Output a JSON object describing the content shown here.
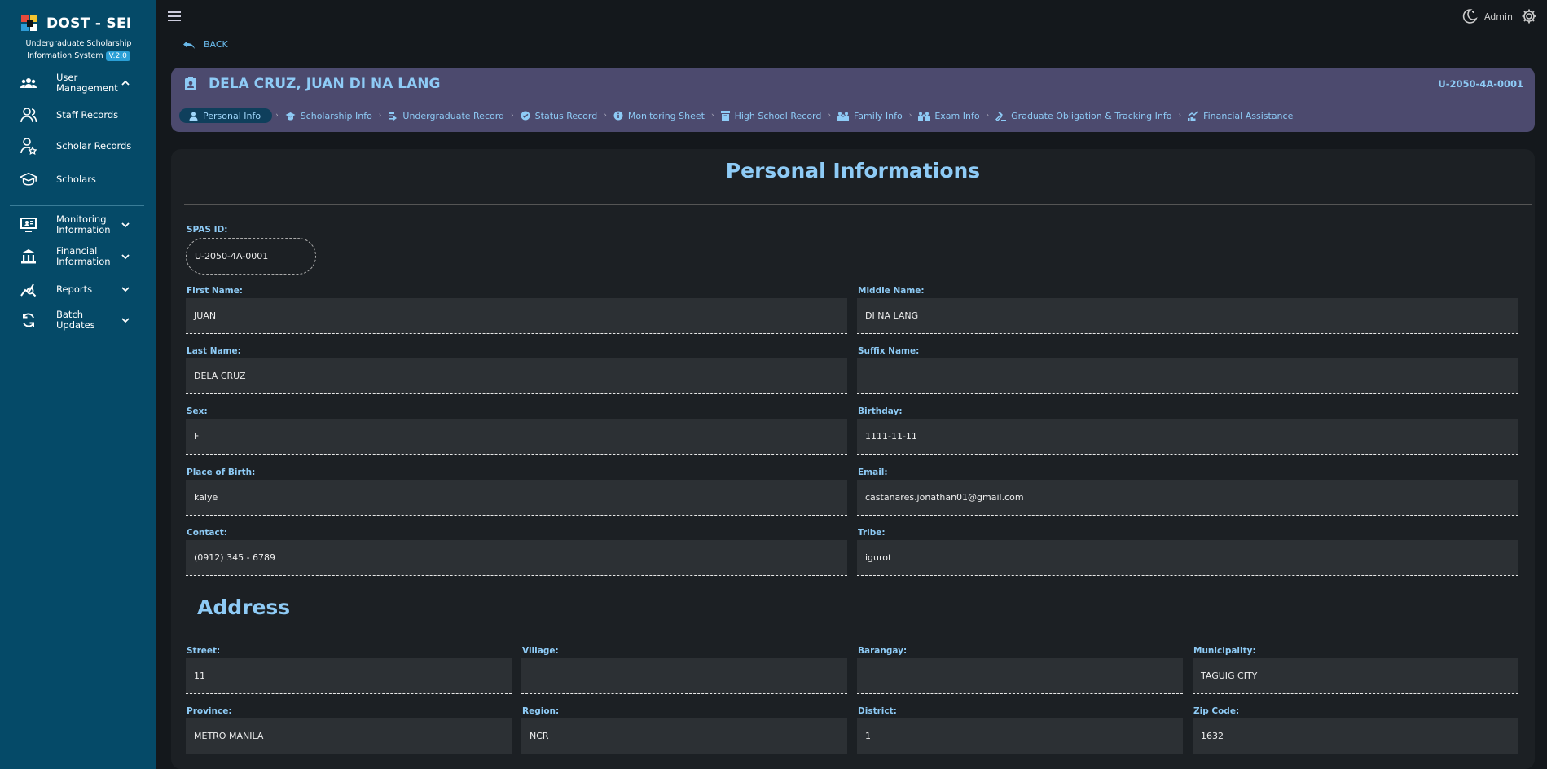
{
  "brand": {
    "title": "DOST - SEI",
    "subtitle_line1": "Undergraduate Scholarship",
    "subtitle_line2": "Information System",
    "version": "V.2.0"
  },
  "sidebar": {
    "items": [
      {
        "label1": "User",
        "label2": "Management",
        "icon": "users-icon"
      },
      {
        "label1": "Staff Records",
        "icon": "staff-icon"
      },
      {
        "label1": "Scholar Records",
        "icon": "scholar-records-icon"
      },
      {
        "label1": "Scholars",
        "icon": "graduation-cap-icon"
      },
      {
        "label1": "Monitoring",
        "label2": "Information",
        "icon": "monitor-icon"
      },
      {
        "label1": "Financial",
        "label2": "Information",
        "icon": "bank-icon"
      },
      {
        "label1": "Reports",
        "icon": "reports-icon"
      },
      {
        "label1": "Batch",
        "label2": "Updates",
        "icon": "sync-icon"
      }
    ]
  },
  "topbar": {
    "user": "Admin"
  },
  "back_label": "BACK",
  "header": {
    "name": "DELA CRUZ, JUAN DI NA LANG",
    "id": "U-2050-4A-0001",
    "tabs": [
      "Personal Info",
      "Scholarship Info",
      "Undergraduate Record",
      "Status Record",
      "Monitoring Sheet",
      "High School Record",
      "Family Info",
      "Exam Info",
      "Graduate Obligation & Tracking Info",
      "Financial Assistance"
    ]
  },
  "personal": {
    "title": "Personal Informations",
    "spas_label": "SPAS ID:",
    "spas_value": "U-2050-4A-0001",
    "first_label": "First Name:",
    "first_value": "JUAN",
    "middle_label": "Middle Name:",
    "middle_value": "DI NA LANG",
    "last_label": "Last Name:",
    "last_value": "DELA CRUZ",
    "suffix_label": "Suffix Name:",
    "suffix_value": "",
    "sex_label": "Sex:",
    "sex_value": "F",
    "birthday_label": "Birthday:",
    "birthday_value": "1111-11-11",
    "pob_label": "Place of Birth:",
    "pob_value": "kalye",
    "email_label": "Email:",
    "email_value": "castanares.jonathan01@gmail.com",
    "contact_label": "Contact:",
    "contact_value": "(0912) 345 - 6789",
    "tribe_label": "Tribe:",
    "tribe_value": "igurot"
  },
  "address": {
    "title": "Address",
    "street_label": "Street:",
    "street_value": "11",
    "village_label": "Village:",
    "village_value": "",
    "barangay_label": "Barangay:",
    "barangay_value": "",
    "municipality_label": "Municipality:",
    "municipality_value": "TAGUIG CITY",
    "province_label": "Province:",
    "province_value": "METRO MANILA",
    "region_label": "Region:",
    "region_value": "NCR",
    "district_label": "District:",
    "district_value": "1",
    "zip_label": "Zip Code:",
    "zip_value": "1632"
  },
  "colors": {
    "sidebar": "#054a68",
    "accent": "#8ecbf6",
    "header_card": "#4c4a6e",
    "panel": "#1c2024"
  }
}
